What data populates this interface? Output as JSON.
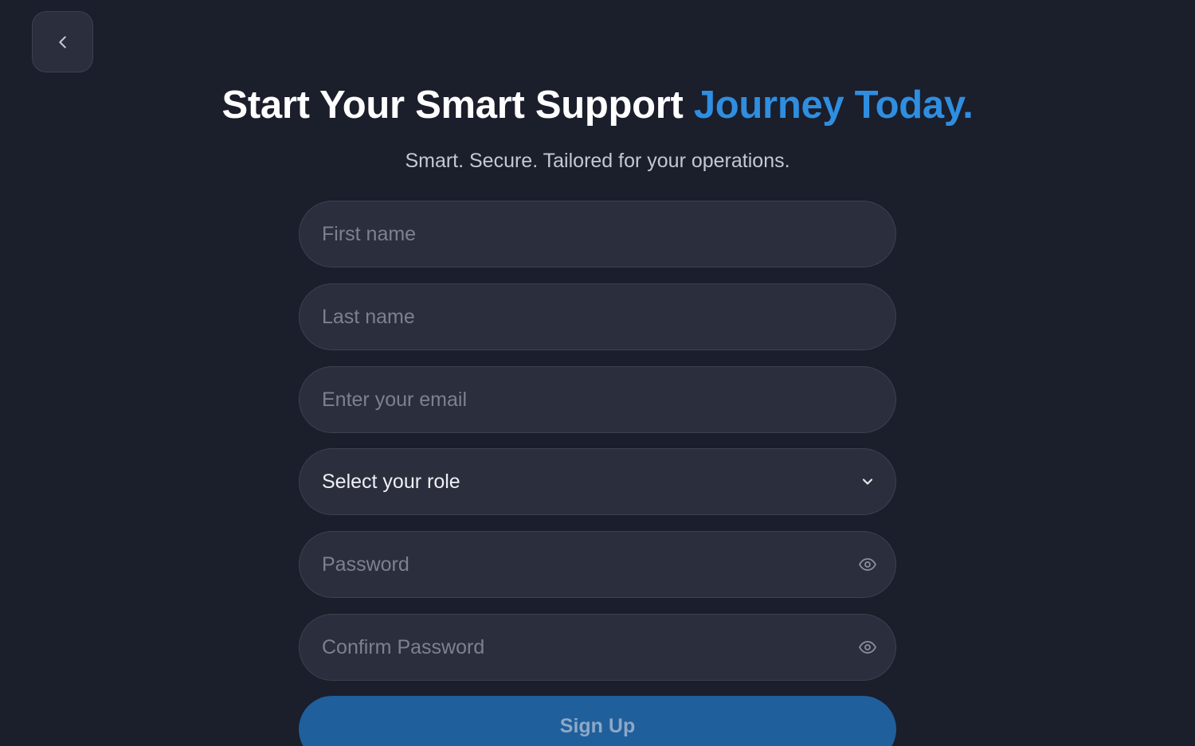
{
  "header": {
    "title_main": "Start Your Smart Support ",
    "title_accent": "Journey Today.",
    "subtitle": "Smart. Secure. Tailored for your operations."
  },
  "form": {
    "first_name": {
      "placeholder": "First name",
      "value": ""
    },
    "last_name": {
      "placeholder": "Last name",
      "value": ""
    },
    "email": {
      "placeholder": "Enter your email",
      "value": ""
    },
    "role": {
      "selected": "Select your role"
    },
    "password": {
      "placeholder": "Password",
      "value": ""
    },
    "confirm_password": {
      "placeholder": "Confirm Password",
      "value": ""
    },
    "submit_label": "Sign Up"
  },
  "icons": {
    "back": "chevron-left-icon",
    "role_dropdown": "chevron-down-icon",
    "password_toggle": "eye-icon",
    "confirm_password_toggle": "eye-icon"
  },
  "colors": {
    "background": "#1b1e2b",
    "field_background": "#2b2e3c",
    "accent": "#2f8ee0",
    "button": "#1f5f9c"
  }
}
